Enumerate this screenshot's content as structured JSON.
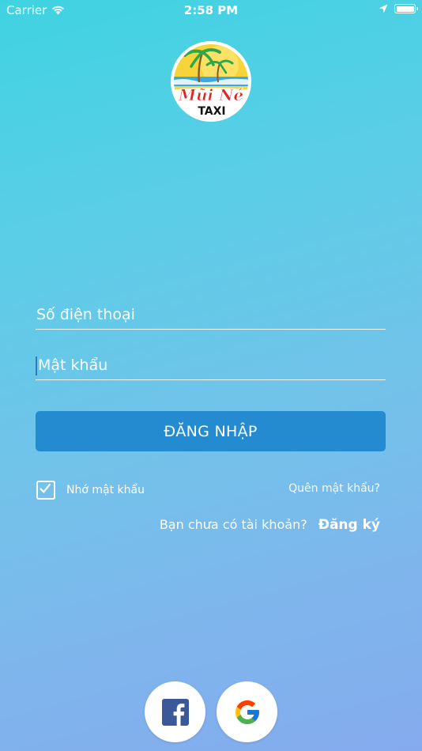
{
  "status_bar": {
    "carrier": "Carrier",
    "time": "2:58 PM",
    "icons": [
      "wifi-icon",
      "location-arrow-icon",
      "battery-icon"
    ]
  },
  "logo": {
    "line1": "Mũi Né",
    "line2": "TAXI",
    "colors": {
      "sun": "#f7d43a",
      "sea": "#39a9de",
      "red": "#e02424",
      "palm": "#2aa84a"
    }
  },
  "form": {
    "phone_placeholder": "Số điện thoại",
    "phone_value": "",
    "password_placeholder": "Mật khẩu",
    "password_value": ""
  },
  "login_button": {
    "label": "ĐĂNG NHẬP",
    "color": "#258bd0"
  },
  "remember": {
    "label": "Nhớ mật khẩu",
    "checked": true
  },
  "forgot_label": "Quên mật khẩu?",
  "register": {
    "question": "Bạn chưa có tài khoản?",
    "link": "Đăng ký"
  },
  "social": {
    "facebook_icon": "facebook-icon",
    "google_icon": "google-icon",
    "facebook_color": "#3b5998"
  }
}
